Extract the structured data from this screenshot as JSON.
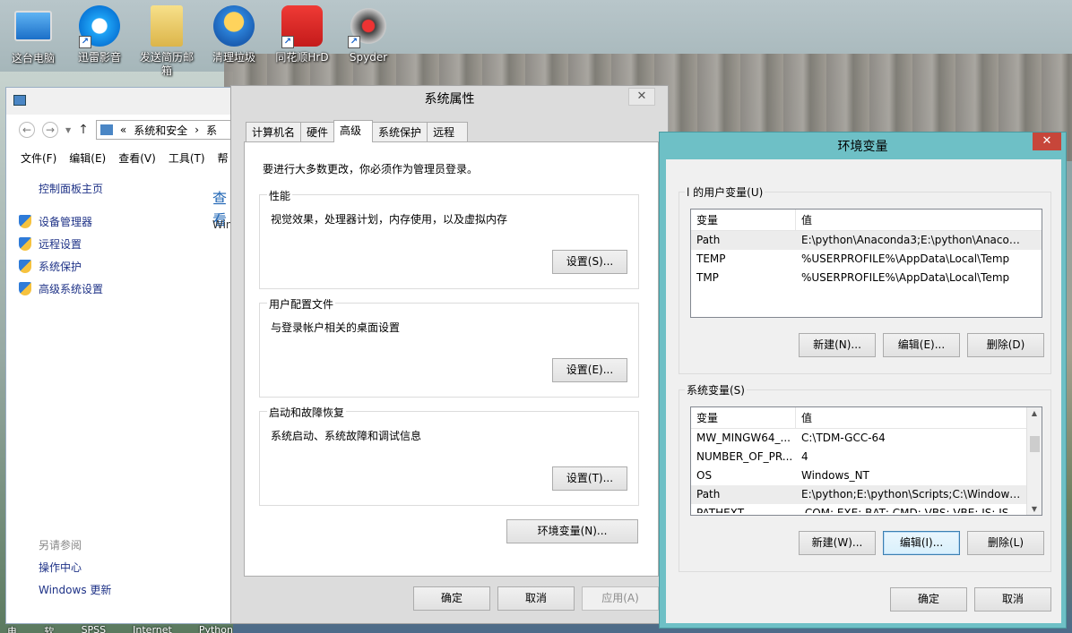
{
  "desktop": {
    "icons": [
      {
        "label": "这台电脑",
        "icon": "computer-icon"
      },
      {
        "label": "迅雷影音",
        "icon": "xunlei-player-icon"
      },
      {
        "label": "发送简历邮箱",
        "icon": "folder-icon"
      },
      {
        "label": "清理垃圾",
        "icon": "cleanup-broom-icon"
      },
      {
        "label": "同花顺HrD",
        "icon": "tonghuashun-icon"
      },
      {
        "label": "Spyder",
        "icon": "spyder-icon"
      }
    ]
  },
  "explorer": {
    "address": {
      "chevrons": "«",
      "path1": "系统和安全",
      "sep": "›",
      "path2": "系"
    },
    "menu": [
      "文件(F)",
      "编辑(E)",
      "查看(V)",
      "工具(T)",
      "帮"
    ],
    "home_link": "控制面板主页",
    "nav_items": [
      "设备管理器",
      "远程设置",
      "系统保护",
      "高级系统设置"
    ],
    "see_also": "另请参阅",
    "links": [
      "操作中心",
      "Windows 更新"
    ],
    "cropped_heading": "查看",
    "cropped_text": "Win"
  },
  "system_properties": {
    "title": "系统属性",
    "close": "✕",
    "tabs": [
      "计算机名",
      "硬件",
      "高级",
      "系统保护",
      "远程"
    ],
    "active_tab": "高级",
    "admin_note": "要进行大多数更改，你必须作为管理员登录。",
    "performance": {
      "title": "性能",
      "desc": "视觉效果，处理器计划，内存使用，以及虚拟内存",
      "button": "设置(S)..."
    },
    "user_profiles": {
      "title": "用户配置文件",
      "desc": "与登录帐户相关的桌面设置",
      "button": "设置(E)..."
    },
    "startup_recovery": {
      "title": "启动和故障恢复",
      "desc": "系统启动、系统故障和调试信息",
      "button": "设置(T)..."
    },
    "env_button": "环境变量(N)...",
    "ok": "确定",
    "cancel": "取消",
    "apply": "应用(A)"
  },
  "env_vars": {
    "title": "环境变量",
    "close": "✕",
    "user_vars": {
      "title": "l 的用户变量(U)",
      "columns": [
        "变量",
        "值"
      ],
      "rows": [
        {
          "name": "Path",
          "value": "E:\\python\\Anaconda3;E:\\python\\Anacon..."
        },
        {
          "name": "TEMP",
          "value": "%USERPROFILE%\\AppData\\Local\\Temp"
        },
        {
          "name": "TMP",
          "value": "%USERPROFILE%\\AppData\\Local\\Temp"
        }
      ],
      "buttons": {
        "new": "新建(N)...",
        "edit": "编辑(E)...",
        "delete": "删除(D)"
      }
    },
    "system_vars": {
      "title": "系统变量(S)",
      "columns": [
        "变量",
        "值"
      ],
      "rows": [
        {
          "name": "MW_MINGW64_...",
          "value": "C:\\TDM-GCC-64"
        },
        {
          "name": "NUMBER_OF_PR...",
          "value": "4"
        },
        {
          "name": "OS",
          "value": "Windows_NT"
        },
        {
          "name": "Path",
          "value": "E:\\python;E:\\python\\Scripts;C:\\Windows\\..."
        },
        {
          "name": "PATHEXT",
          "value": ".COM;.EXE;.BAT;.CMD;.VBS;.VBE;.JS;.JSE;..."
        }
      ],
      "buttons": {
        "new": "新建(W)...",
        "edit": "编辑(I)...",
        "delete": "删除(L)"
      }
    },
    "ok": "确定",
    "cancel": "取消"
  },
  "taskbar_hint": [
    "电脑管家",
    "软件管理",
    "SPSS",
    "Internet",
    "Python"
  ]
}
